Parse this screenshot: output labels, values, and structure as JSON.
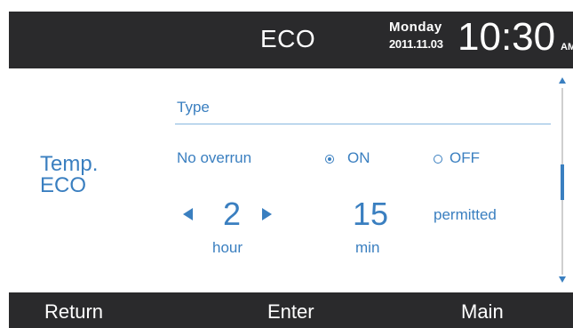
{
  "header": {
    "title": "ECO",
    "day": "Monday",
    "date": "2011.11.03",
    "time": "10:30",
    "ampm": "AM"
  },
  "main": {
    "side_label_line1": "Temp.",
    "side_label_line2": "ECO",
    "type_label": "Type",
    "option_label": "No overrun",
    "on_label": "ON",
    "off_label": "OFF",
    "selected": "ON",
    "hour_value": "2",
    "hour_unit": "hour",
    "min_value": "15",
    "min_unit": "min",
    "permitted_label": "permitted"
  },
  "scrollbar": {
    "position": 0.4
  },
  "footer": {
    "return_label": "Return",
    "enter_label": "Enter",
    "main_label": "Main"
  },
  "colors": {
    "accent": "#3a7fc0",
    "bar": "#2a2a2c"
  },
  "icons": {
    "decrement": "triangle-left-icon",
    "increment": "triangle-right-icon",
    "scroll_up": "triangle-up-icon",
    "scroll_down": "triangle-down-icon"
  }
}
